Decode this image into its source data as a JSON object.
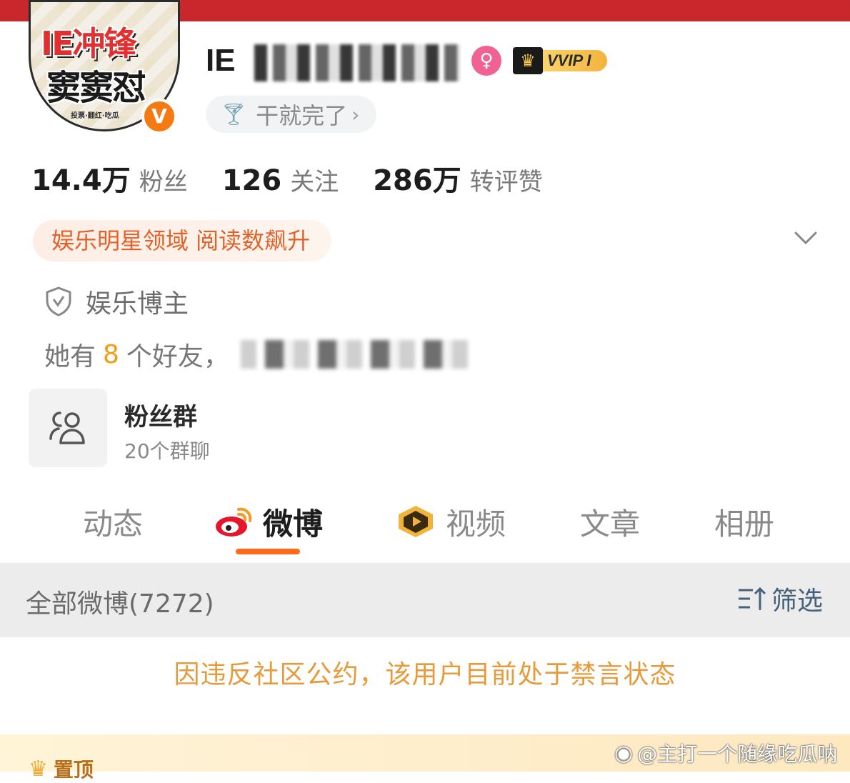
{
  "profile": {
    "avatar_text_line1": "IE冲锋",
    "avatar_text_line2": "窦窦怼",
    "avatar_small_text": "投票·翻红·吃瓜",
    "verified_mark": "V",
    "username": "IE",
    "gender_icon": "female-icon",
    "vip_label": "VVIP I",
    "signature": "干就完了",
    "signature_icon": "cocktail-icon"
  },
  "stats": [
    {
      "value": "14.4万",
      "label": "粉丝"
    },
    {
      "value": "126",
      "label": "关注"
    },
    {
      "value": "286万",
      "label": "转评赞"
    }
  ],
  "rank_pill": "娱乐明星领域 阅读数飙升",
  "role": "娱乐博主",
  "friends": {
    "prefix": "她有",
    "count": "8",
    "suffix": "个好友，"
  },
  "fan_group": {
    "title": "粉丝群",
    "subtitle": "20个群聊"
  },
  "tabs": [
    {
      "label": "动态",
      "active": false
    },
    {
      "label": "微博",
      "active": true
    },
    {
      "label": "视频",
      "active": false
    },
    {
      "label": "文章",
      "active": false
    },
    {
      "label": "相册",
      "active": false
    }
  ],
  "filter_bar": {
    "all_label": "全部微博(7272)",
    "filter_label": "筛选"
  },
  "ban_notice": "因违反社区公约，该用户目前处于禁言状态",
  "pinned": {
    "label": "置顶"
  },
  "watermark": "@主打一个随缘吃瓜呐",
  "colors": {
    "accent": "#ff6a1a",
    "top_bar": "#c8272b",
    "ban_text": "#e89a3a",
    "rank_text": "#e2622a"
  }
}
